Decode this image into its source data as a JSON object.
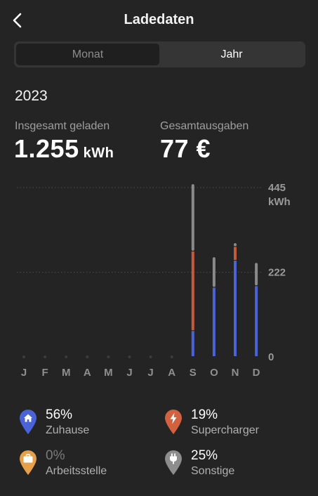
{
  "header": {
    "title": "Ladedaten",
    "back_icon": "chevron-left-icon"
  },
  "tabs": [
    {
      "label": "Monat",
      "selected": false
    },
    {
      "label": "Jahr",
      "selected": true
    }
  ],
  "year": "2023",
  "stats": {
    "total_label": "Insgesamt geladen",
    "total_value": "1.255",
    "total_unit": "kWh",
    "cost_label": "Gesamtausgaben",
    "cost_value": "77 €"
  },
  "chart_data": {
    "type": "bar",
    "stacked": true,
    "categories": [
      "J",
      "F",
      "M",
      "A",
      "M",
      "J",
      "J",
      "A",
      "S",
      "O",
      "N",
      "D"
    ],
    "y_ticks": [
      "0",
      "222",
      "445"
    ],
    "y_unit": "kWh",
    "ylim": [
      0,
      445
    ],
    "series": [
      {
        "name": "Zuhause",
        "color": "#4a63d6",
        "values": [
          0,
          0,
          0,
          0,
          0,
          0,
          0,
          0,
          68,
          182,
          253,
          186
        ]
      },
      {
        "name": "Supercharger",
        "color": "#c45a3b",
        "values": [
          0,
          0,
          0,
          0,
          0,
          0,
          0,
          0,
          209,
          0,
          36,
          0
        ]
      },
      {
        "name": "Arbeitsstelle",
        "color": "#e29a3a",
        "values": [
          0,
          0,
          0,
          0,
          0,
          0,
          0,
          0,
          0,
          0,
          0,
          0
        ]
      },
      {
        "name": "Sonstige",
        "color": "#8a8a8a",
        "values": [
          0,
          0,
          0,
          0,
          0,
          0,
          0,
          0,
          177,
          80,
          10,
          61
        ]
      }
    ],
    "grid": "dotted"
  },
  "legend": [
    {
      "pct": "56%",
      "label": "Zuhause",
      "color": "#4a63d6",
      "icon": "home-icon"
    },
    {
      "pct": "19%",
      "label": "Supercharger",
      "color": "#d2623f",
      "icon": "lightning-icon"
    },
    {
      "pct": "0%",
      "label": "Arbeitsstelle",
      "color": "#e7a04a",
      "icon": "briefcase-icon"
    },
    {
      "pct": "25%",
      "label": "Sonstige",
      "color": "#8d8d8d",
      "icon": "plug-icon"
    }
  ]
}
